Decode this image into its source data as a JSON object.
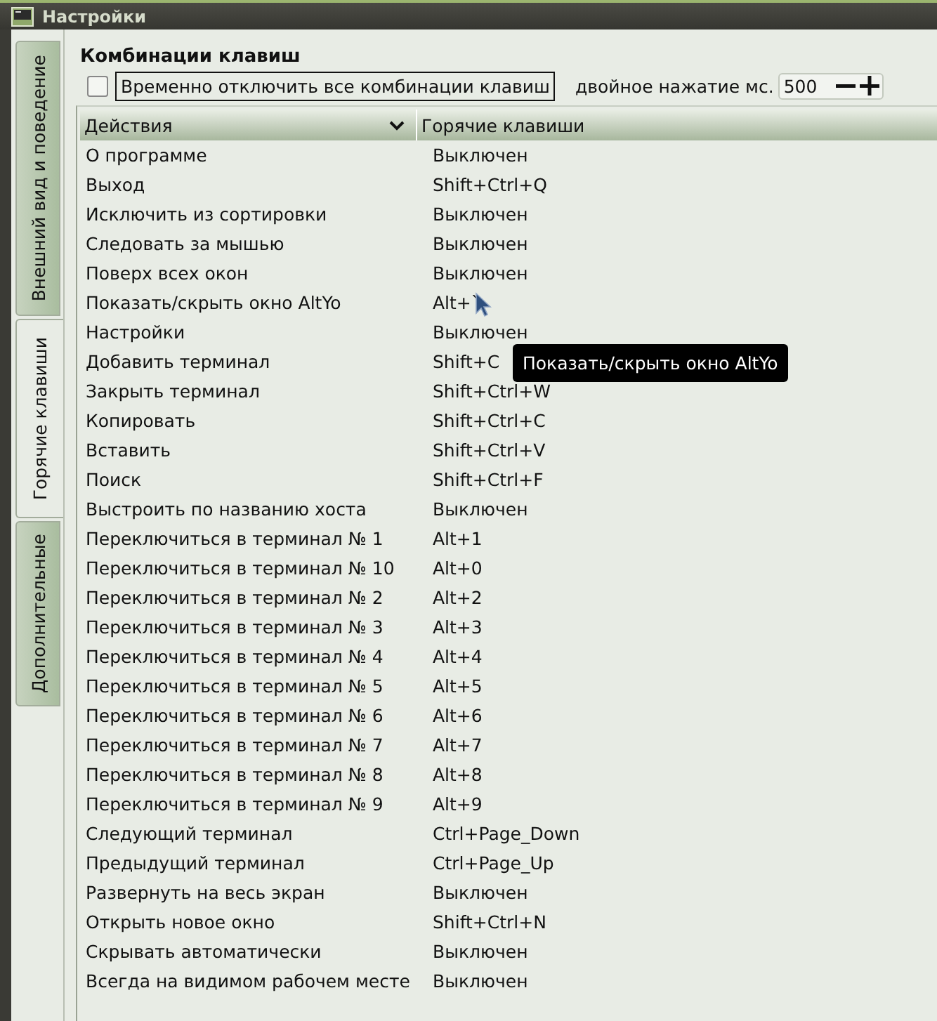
{
  "window": {
    "title": "Настройки"
  },
  "tabs": [
    {
      "label": "Внешний вид и поведение",
      "selected": false
    },
    {
      "label": "Горячие клавиши",
      "selected": true
    },
    {
      "label": "Дополнительные",
      "selected": false
    }
  ],
  "section_title": "Комбинации клавиш",
  "disable_all": {
    "label": "Временно отключить все комбинации клавиш",
    "checked": false
  },
  "double_press": {
    "label": "двойное нажатие мс.",
    "value": "500"
  },
  "table": {
    "columns": [
      {
        "label": "Действия",
        "sorted": true
      },
      {
        "label": "Горячие клавиши",
        "sorted": false
      }
    ],
    "rows": [
      {
        "action": "О программе",
        "hotkey": "Выключен"
      },
      {
        "action": "Выход",
        "hotkey": "Shift+Ctrl+Q"
      },
      {
        "action": "Исключить из сортировки",
        "hotkey": "Выключен"
      },
      {
        "action": "Следовать за мышью",
        "hotkey": "Выключен"
      },
      {
        "action": "Поверх всех окон",
        "hotkey": "Выключен"
      },
      {
        "action": "Показать/скрыть окно AltYo",
        "hotkey": "Alt+`"
      },
      {
        "action": "Настройки",
        "hotkey": "Выключен"
      },
      {
        "action": "Добавить терминал",
        "hotkey": "Shift+C"
      },
      {
        "action": "Закрыть терминал",
        "hotkey": "Shift+Ctrl+W"
      },
      {
        "action": "Копировать",
        "hotkey": "Shift+Ctrl+C"
      },
      {
        "action": "Вставить",
        "hotkey": "Shift+Ctrl+V"
      },
      {
        "action": "Поиск",
        "hotkey": "Shift+Ctrl+F"
      },
      {
        "action": "Выстроить по названию хоста",
        "hotkey": "Выключен"
      },
      {
        "action": "Переключиться в терминал № 1",
        "hotkey": "Alt+1"
      },
      {
        "action": "Переключиться в терминал № 10",
        "hotkey": "Alt+0"
      },
      {
        "action": "Переключиться в терминал № 2",
        "hotkey": "Alt+2"
      },
      {
        "action": "Переключиться в терминал № 3",
        "hotkey": "Alt+3"
      },
      {
        "action": "Переключиться в терминал № 4",
        "hotkey": "Alt+4"
      },
      {
        "action": "Переключиться в терминал № 5",
        "hotkey": "Alt+5"
      },
      {
        "action": "Переключиться в терминал № 6",
        "hotkey": "Alt+6"
      },
      {
        "action": "Переключиться в терминал № 7",
        "hotkey": "Alt+7"
      },
      {
        "action": "Переключиться в терминал № 8",
        "hotkey": "Alt+8"
      },
      {
        "action": "Переключиться в терминал № 9",
        "hotkey": "Alt+9"
      },
      {
        "action": "Следующий терминал",
        "hotkey": "Ctrl+Page_Down"
      },
      {
        "action": "Предыдущий терминал",
        "hotkey": "Ctrl+Page_Up"
      },
      {
        "action": "Развернуть на весь экран",
        "hotkey": "Выключен"
      },
      {
        "action": "Открыть новое окно",
        "hotkey": "Shift+Ctrl+N"
      },
      {
        "action": "Скрывать автоматически",
        "hotkey": "Выключен"
      },
      {
        "action": "Всегда на видимом рабочем месте",
        "hotkey": "Выключен"
      }
    ]
  },
  "tooltip": "Показать/скрыть окно AltYo"
}
